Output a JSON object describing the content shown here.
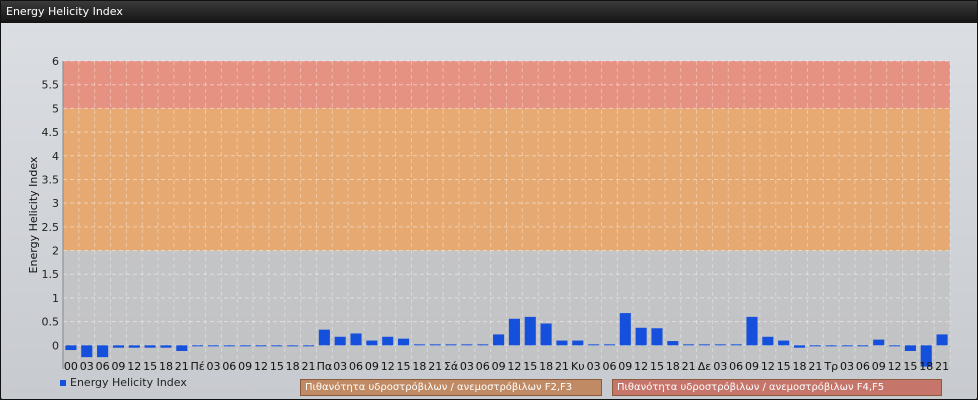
{
  "window": {
    "title": "Energy Helicity Index"
  },
  "colors": {
    "bar": "#1450dc",
    "zone_low": "#bfbfbf",
    "zone_mid": "#e8a466",
    "zone_high": "#e88a78"
  },
  "legend": {
    "series_label": "Energy Helicity Index"
  },
  "zones": [
    {
      "label": "Πιθανότητα υδροστρόβιλων / ανεμοστρόβιλων F2,F3",
      "from": 2,
      "to": 5
    },
    {
      "label": "Πιθανότητα υδροστρόβιλων / ανεμοστρόβιλων F4,F5",
      "from": 5,
      "to": 6
    }
  ],
  "chart_data": {
    "type": "bar",
    "title": "",
    "xlabel": "",
    "ylabel": "Energy Helicity Index",
    "ylim": [
      -0.5,
      6
    ],
    "yticks": [
      0,
      0.5,
      1,
      1.5,
      2,
      2.5,
      3,
      3.5,
      4,
      4.5,
      5,
      5.5,
      6
    ],
    "grid": true,
    "legend_position": "bottom-left",
    "categories": [
      "00",
      "03",
      "06",
      "09",
      "12",
      "15",
      "18",
      "21",
      "Πέ",
      "03",
      "06",
      "09",
      "12",
      "15",
      "18",
      "21",
      "Πα",
      "03",
      "06",
      "09",
      "12",
      "15",
      "18",
      "21",
      "Σά",
      "03",
      "06",
      "09",
      "12",
      "15",
      "18",
      "21",
      "Κυ",
      "03",
      "06",
      "09",
      "12",
      "15",
      "18",
      "21",
      "Δε",
      "03",
      "06",
      "09",
      "12",
      "15",
      "18",
      "21",
      "Τρ",
      "03",
      "06",
      "09",
      "12",
      "15",
      "18",
      "21"
    ],
    "series": [
      {
        "name": "Energy Helicity Index",
        "values": [
          -0.1,
          -0.25,
          -0.25,
          -0.05,
          -0.05,
          -0.05,
          -0.05,
          -0.12,
          -0.02,
          -0.02,
          -0.02,
          -0.02,
          -0.02,
          -0.02,
          -0.02,
          -0.02,
          0.33,
          0.18,
          0.25,
          0.1,
          0.18,
          0.14,
          0.02,
          0.02,
          0.02,
          0.02,
          0.02,
          0.23,
          0.56,
          0.6,
          0.46,
          0.1,
          0.1,
          0.02,
          0.02,
          0.68,
          0.37,
          0.36,
          0.09,
          0.02,
          0.02,
          0.02,
          0.02,
          0.6,
          0.18,
          0.1,
          -0.05,
          -0.02,
          -0.02,
          -0.02,
          -0.02,
          0.12,
          -0.02,
          -0.12,
          -0.45,
          0.23
        ]
      }
    ]
  }
}
